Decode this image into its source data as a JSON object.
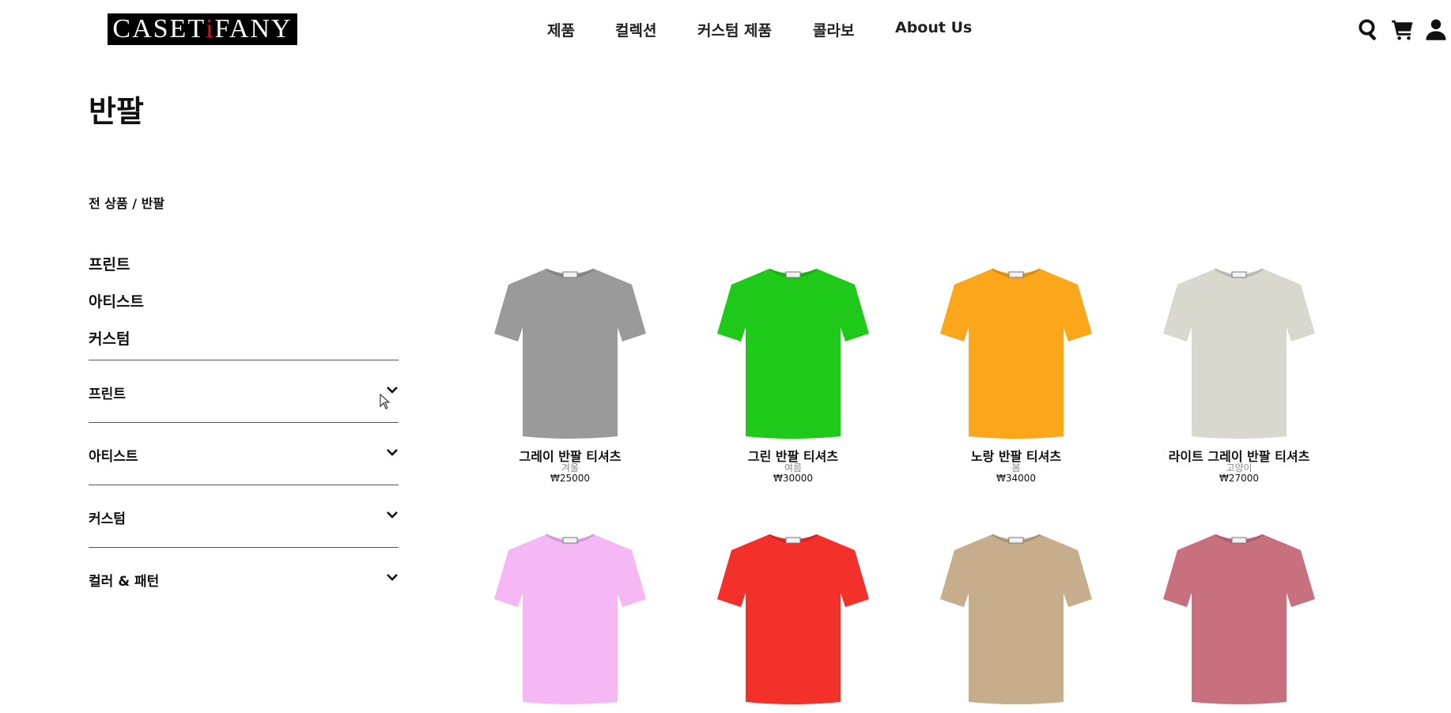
{
  "brand": {
    "logo_text_before": "CASET",
    "logo_text_dot": "i",
    "logo_text_after": "FANY",
    "logo_colors": {
      "background": "#000000",
      "text": "#ffffff",
      "dot": "#e0141e"
    }
  },
  "nav": {
    "items": [
      "제품",
      "컬렉션",
      "커스텀 제품",
      "콜라보",
      "About Us"
    ]
  },
  "header_icons": [
    "search-icon",
    "cart-icon",
    "user-icon"
  ],
  "page": {
    "title": "반팔",
    "breadcrumb": "전 상품 / 반팔"
  },
  "sidebar": {
    "quick_links": [
      "프린트",
      "아티스트",
      "커스텀"
    ],
    "filters": [
      "프린트",
      "아티스트",
      "커스텀",
      "컬러 & 패턴"
    ]
  },
  "products": [
    {
      "name": "그레이 반팔 티셔츠",
      "tag": "겨울",
      "price": "₩25000",
      "color": "#9a9a9a"
    },
    {
      "name": "그린 반팔 티셔츠",
      "tag": "여름",
      "price": "₩30000",
      "color": "#1fc91a"
    },
    {
      "name": "노랑 반팔 티셔츠",
      "tag": "봄",
      "price": "₩34000",
      "color": "#fba61b"
    },
    {
      "name": "라이트 그레이 반팔 티셔츠",
      "tag": "고양이",
      "price": "₩27000",
      "color": "#d8d8cf"
    },
    {
      "name": "",
      "tag": "",
      "price": "",
      "color": "#f5b8f5"
    },
    {
      "name": "",
      "tag": "",
      "price": "",
      "color": "#f3302a"
    },
    {
      "name": "",
      "tag": "",
      "price": "",
      "color": "#c6ad8b"
    },
    {
      "name": "",
      "tag": "",
      "price": "",
      "color": "#c9707f"
    }
  ]
}
